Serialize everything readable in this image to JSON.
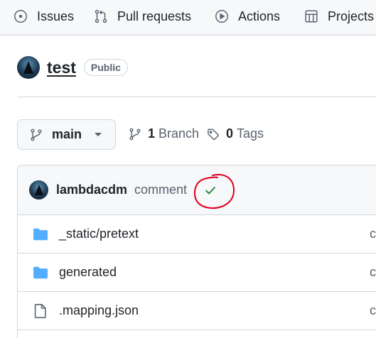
{
  "nav": {
    "items": [
      {
        "label": "Issues",
        "icon": "issue-circle-icon"
      },
      {
        "label": "Pull requests",
        "icon": "pull-request-icon"
      },
      {
        "label": "Actions",
        "icon": "play-circle-icon"
      },
      {
        "label": "Projects",
        "icon": "table-icon"
      }
    ]
  },
  "repo": {
    "name": "test",
    "visibility": "Public"
  },
  "branch": {
    "current": "main",
    "branch_count": "1",
    "branch_label": "Branch",
    "tag_count": "0",
    "tag_label": "Tags"
  },
  "commit": {
    "author": "lambdacdm",
    "message": "comment",
    "status": "success",
    "status_color": "#1a7f37",
    "annotation_color": "#e0001b"
  },
  "files": [
    {
      "name": "_static/pretext",
      "type": "folder",
      "trail": "c"
    },
    {
      "name": "generated",
      "type": "folder",
      "trail": "c"
    },
    {
      "name": ".mapping.json",
      "type": "file",
      "trail": "c"
    }
  ],
  "colors": {
    "folder": "#54aeff",
    "muted": "#59636e",
    "border": "#d0d7de"
  }
}
